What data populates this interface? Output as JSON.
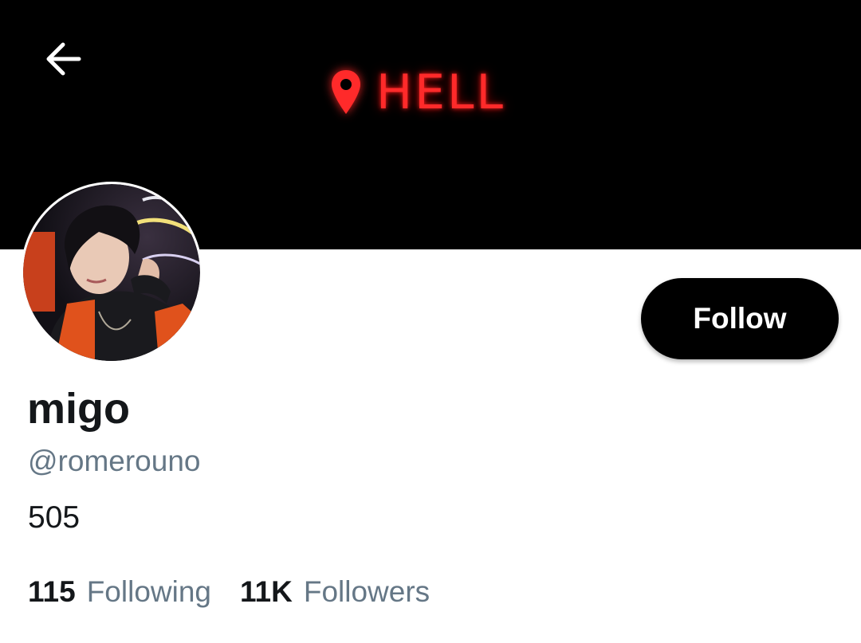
{
  "header": {
    "back_icon": "arrow-left-icon",
    "banner_sign": {
      "icon": "location-pin-icon",
      "text": "HELL",
      "color": "#ff2a2a"
    },
    "banner_color": "#000000"
  },
  "profile": {
    "display_name": "migo",
    "handle": "@romerouno",
    "bio": "505",
    "follow_label": "Follow",
    "following_count": "115",
    "following_label": "Following",
    "followers_count": "11K",
    "followers_label": "Followers"
  },
  "colors": {
    "text_primary": "#14171a",
    "text_secondary": "#657786",
    "button_bg": "#000000",
    "button_text": "#ffffff"
  }
}
